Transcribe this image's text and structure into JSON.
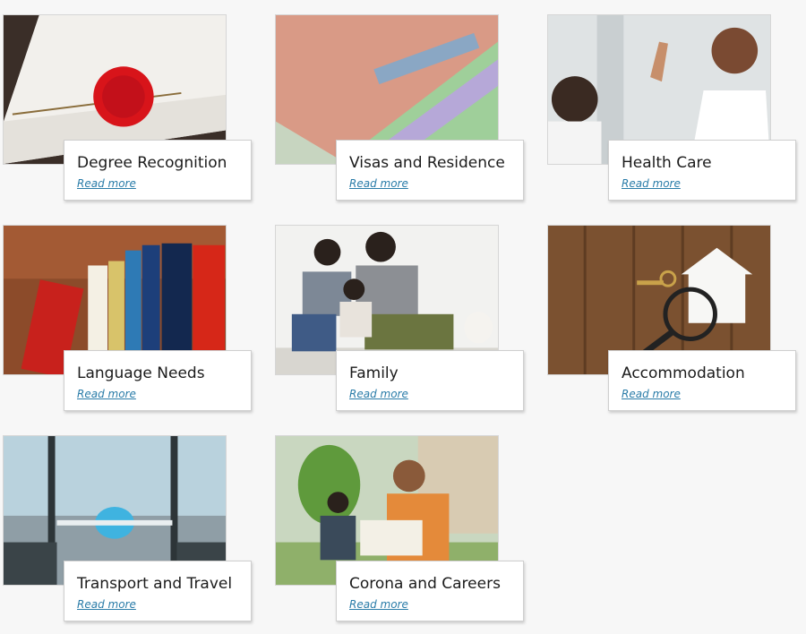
{
  "cards": [
    {
      "title": "Degree Recognition",
      "link": "Read more"
    },
    {
      "title": "Visas and Residence",
      "link": "Read more"
    },
    {
      "title": "Health Care",
      "link": "Read more"
    },
    {
      "title": "Language Needs",
      "link": "Read more"
    },
    {
      "title": "Family",
      "link": "Read more"
    },
    {
      "title": "Accommodation",
      "link": "Read more"
    },
    {
      "title": "Transport and Travel",
      "link": "Read more"
    },
    {
      "title": "Corona and Careers",
      "link": "Read more"
    }
  ],
  "colors": {
    "link": "#2a7ca8",
    "title": "#1b1b1b",
    "background": "#f7f7f7"
  }
}
